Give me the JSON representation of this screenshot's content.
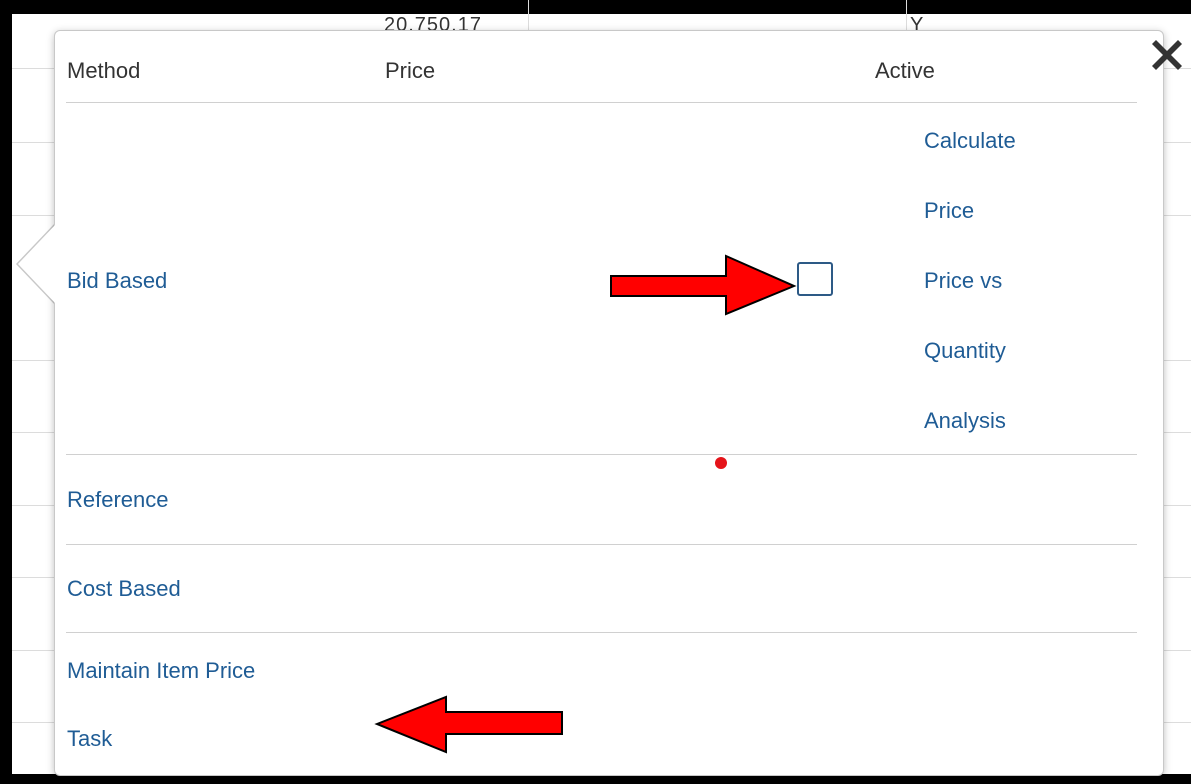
{
  "background": {
    "top_fragments": [
      "20,750.17",
      "Y"
    ]
  },
  "table": {
    "headers": {
      "method": "Method",
      "price": "Price",
      "active": "Active"
    },
    "rows": [
      {
        "method": "Bid Based",
        "active_checked": false,
        "action_lines": [
          "Calculate",
          "Price",
          "Price vs",
          "Quantity",
          "Analysis"
        ]
      },
      {
        "method": "Reference"
      },
      {
        "method": "Cost Based"
      },
      {
        "method_lines": [
          "Maintain Item Price",
          "Task"
        ]
      }
    ]
  },
  "annotations": {
    "arrow_color": "#ff0000",
    "dot_color": "#e5141a"
  },
  "icons": {
    "close": "close-icon"
  },
  "colors": {
    "link": "#1f5c95",
    "header_text": "#333333",
    "checkbox_border": "#2d5a86"
  }
}
